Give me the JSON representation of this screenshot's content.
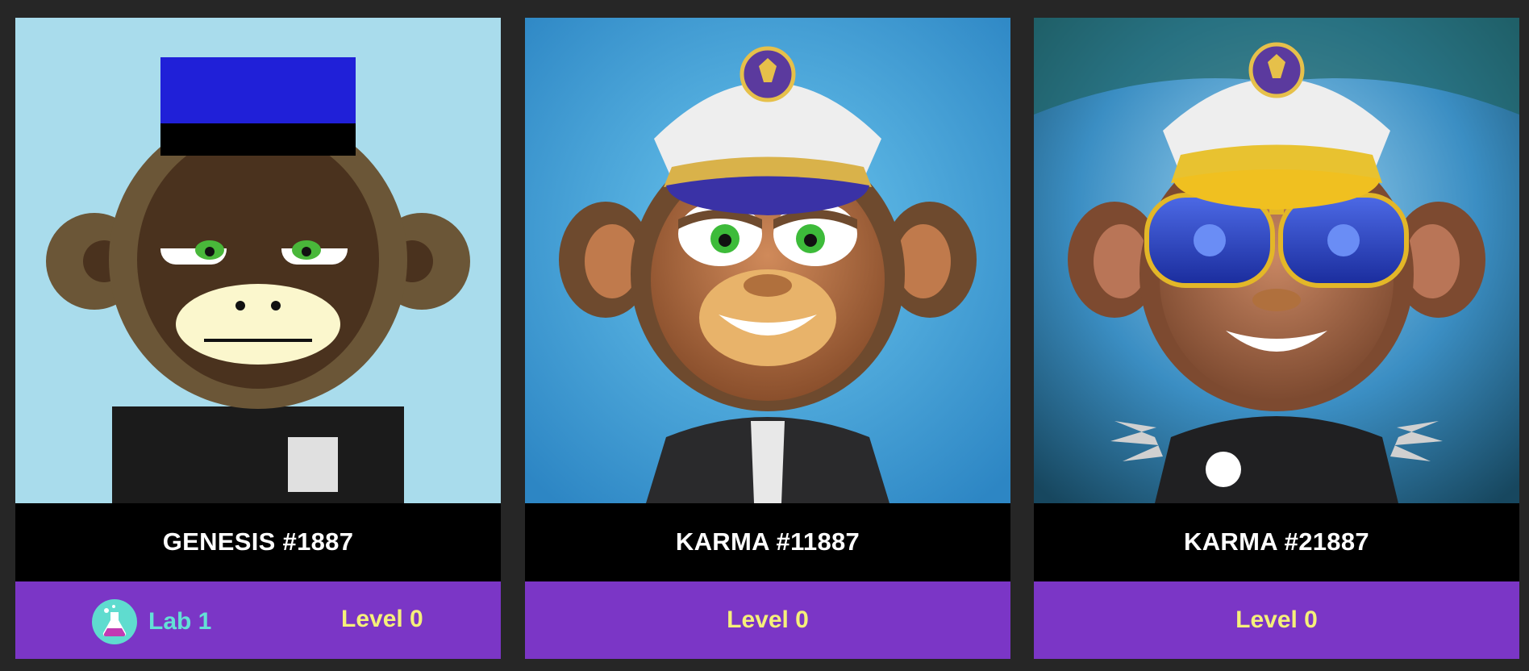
{
  "cards": [
    {
      "name": "GENESIS #1887",
      "art_icon": "pixel-monkey-conductor-art",
      "lab": {
        "label": "Lab 1",
        "icon": "flask-icon"
      },
      "level": "Level 0"
    },
    {
      "name": "KARMA #11887",
      "art_icon": "captain-monkey-art",
      "level": "Level 0"
    },
    {
      "name": "KARMA #21887",
      "art_icon": "gold-captain-monkey-sunglasses-art",
      "level": "Level 0"
    }
  ],
  "colors": {
    "page_bg": "#262626",
    "name_bar_bg": "#000000",
    "footer_bg": "#7b36c6",
    "level_text": "#f5f07a",
    "lab_text": "#63e0d6"
  }
}
